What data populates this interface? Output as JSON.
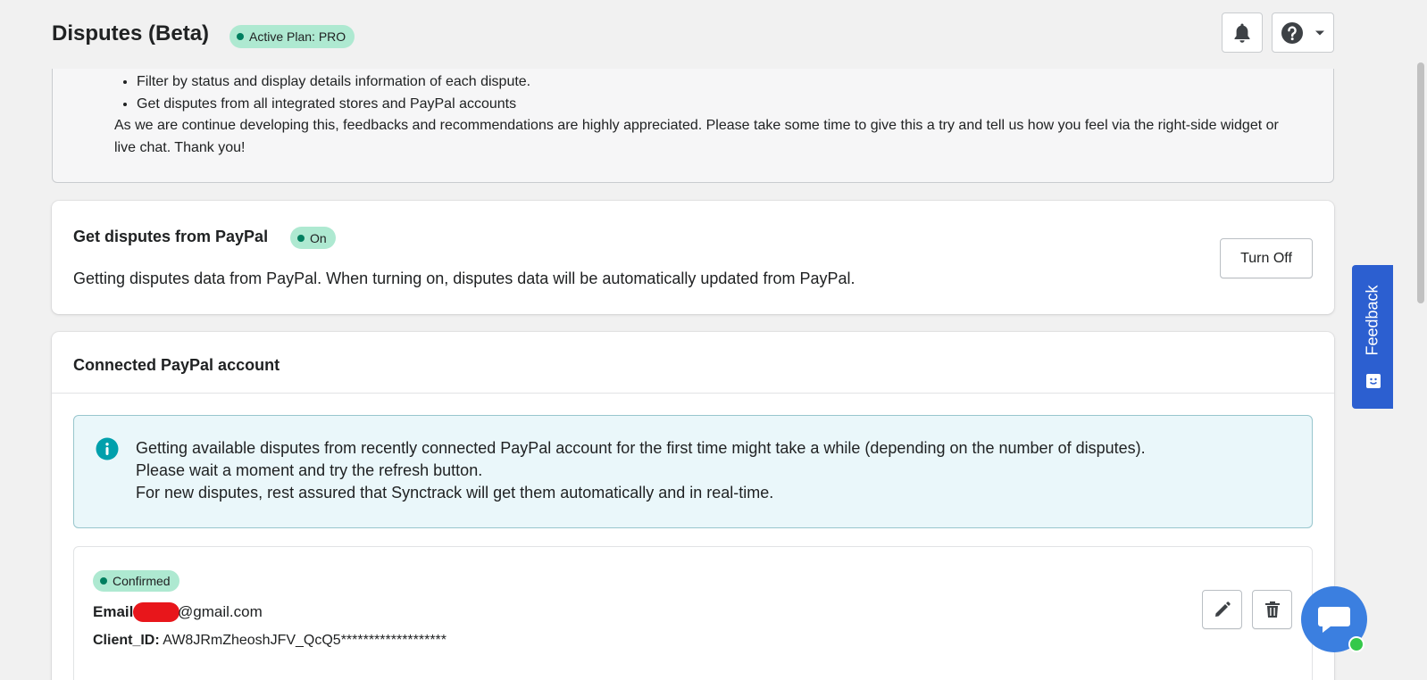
{
  "header": {
    "title": "Disputes (Beta)",
    "plan_badge": "Active Plan: PRO"
  },
  "intro": {
    "bullets": [
      "Filter by status and display details information of each dispute.",
      "Get disputes from all integrated stores and PayPal accounts"
    ],
    "paragraph": "As we are continue developing this, feedbacks and recommendations are highly appreciated. Please take some time to give this a try and tell us how you feel via the right-side widget or live chat. Thank you!"
  },
  "paypal_sync": {
    "title": "Get disputes from PayPal",
    "status": "On",
    "description": "Getting disputes data from PayPal. When turning on, disputes data will be automatically updated from PayPal.",
    "button": "Turn Off"
  },
  "connected_account": {
    "title": "Connected PayPal account",
    "info_lines": [
      "Getting available disputes from recently connected PayPal account for the first time might take a while (depending on the number of disputes).",
      "Please wait a moment and try the refresh button.",
      "For new disputes, rest assured that Synctrack will get them automatically and in real-time."
    ],
    "account": {
      "status": "Confirmed",
      "email_label": "Email:",
      "email_domain": "@gmail.com",
      "client_id_label": "Client_ID:",
      "client_id_value": "AW8JRmZheoshJFV_QcQ5*******************"
    }
  },
  "feedback": {
    "label": "Feedback"
  },
  "colors": {
    "success_badge": "#aee9d1",
    "success_dot": "#007f5f",
    "feedback_tab": "#2c5fd0",
    "chat_button": "#3b7fe0",
    "info_banner_bg": "#eaf7fa",
    "info_icon": "#00a0ac"
  }
}
